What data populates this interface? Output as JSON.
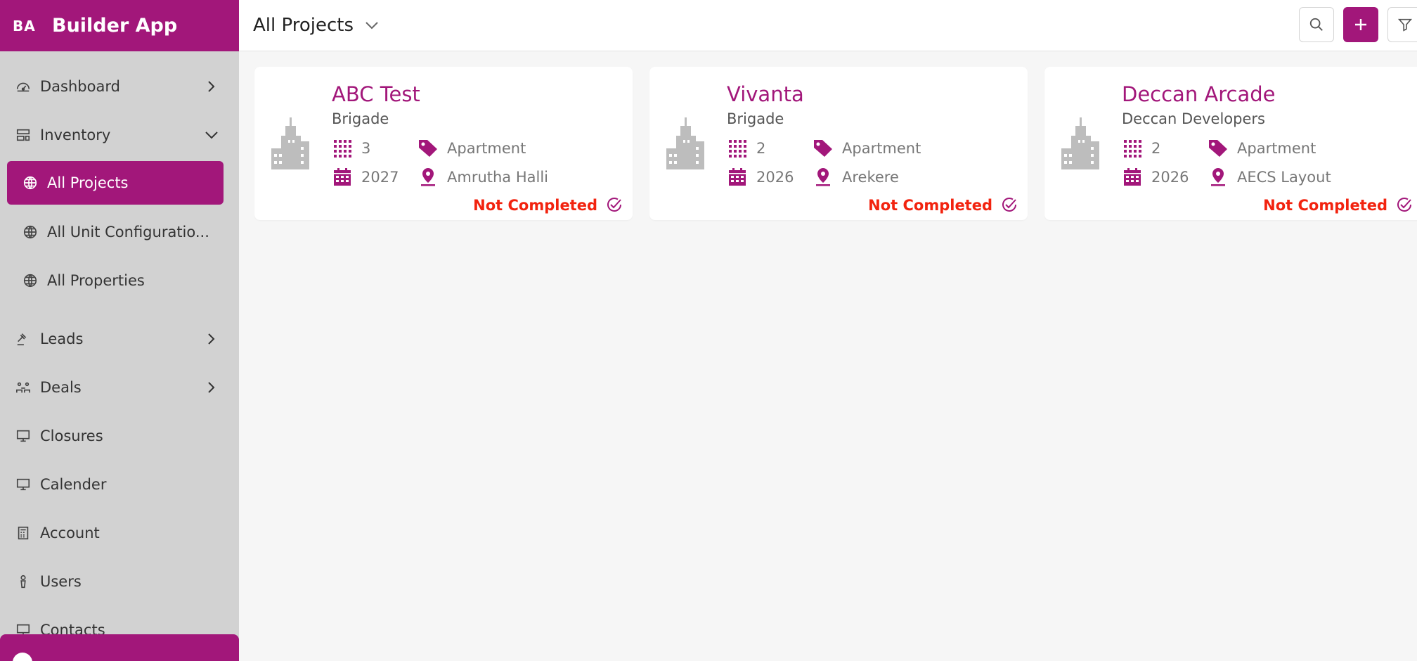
{
  "app": {
    "abbr": "BA",
    "name": "Builder App"
  },
  "sidebar": {
    "items": [
      {
        "label": "Dashboard"
      },
      {
        "label": "Inventory"
      },
      {
        "label": "All Projects"
      },
      {
        "label": "All Unit Configuratio..."
      },
      {
        "label": "All Properties"
      },
      {
        "label": "Leads"
      },
      {
        "label": "Deals"
      },
      {
        "label": "Closures"
      },
      {
        "label": "Calender"
      },
      {
        "label": "Account"
      },
      {
        "label": "Users"
      },
      {
        "label": "Contacts"
      }
    ]
  },
  "header": {
    "title": "All Projects"
  },
  "colors": {
    "brand": "#a2177a",
    "sidebar_bg": "#d2d2d2",
    "status_red": "#f2230f",
    "icon_gray": "#bdbdbd"
  },
  "projects": [
    {
      "name": "ABC Test",
      "developer": "Brigade",
      "units": "3",
      "type": "Apartment",
      "year": "2027",
      "location": "Amrutha Halli",
      "status": "Not Completed"
    },
    {
      "name": "Vivanta",
      "developer": "Brigade",
      "units": "2",
      "type": "Apartment",
      "year": "2026",
      "location": "Arekere",
      "status": "Not Completed"
    },
    {
      "name": "Deccan Arcade",
      "developer": "Deccan Developers",
      "units": "2",
      "type": "Apartment",
      "year": "2026",
      "location": "AECS Layout",
      "status": "Not Completed"
    }
  ]
}
